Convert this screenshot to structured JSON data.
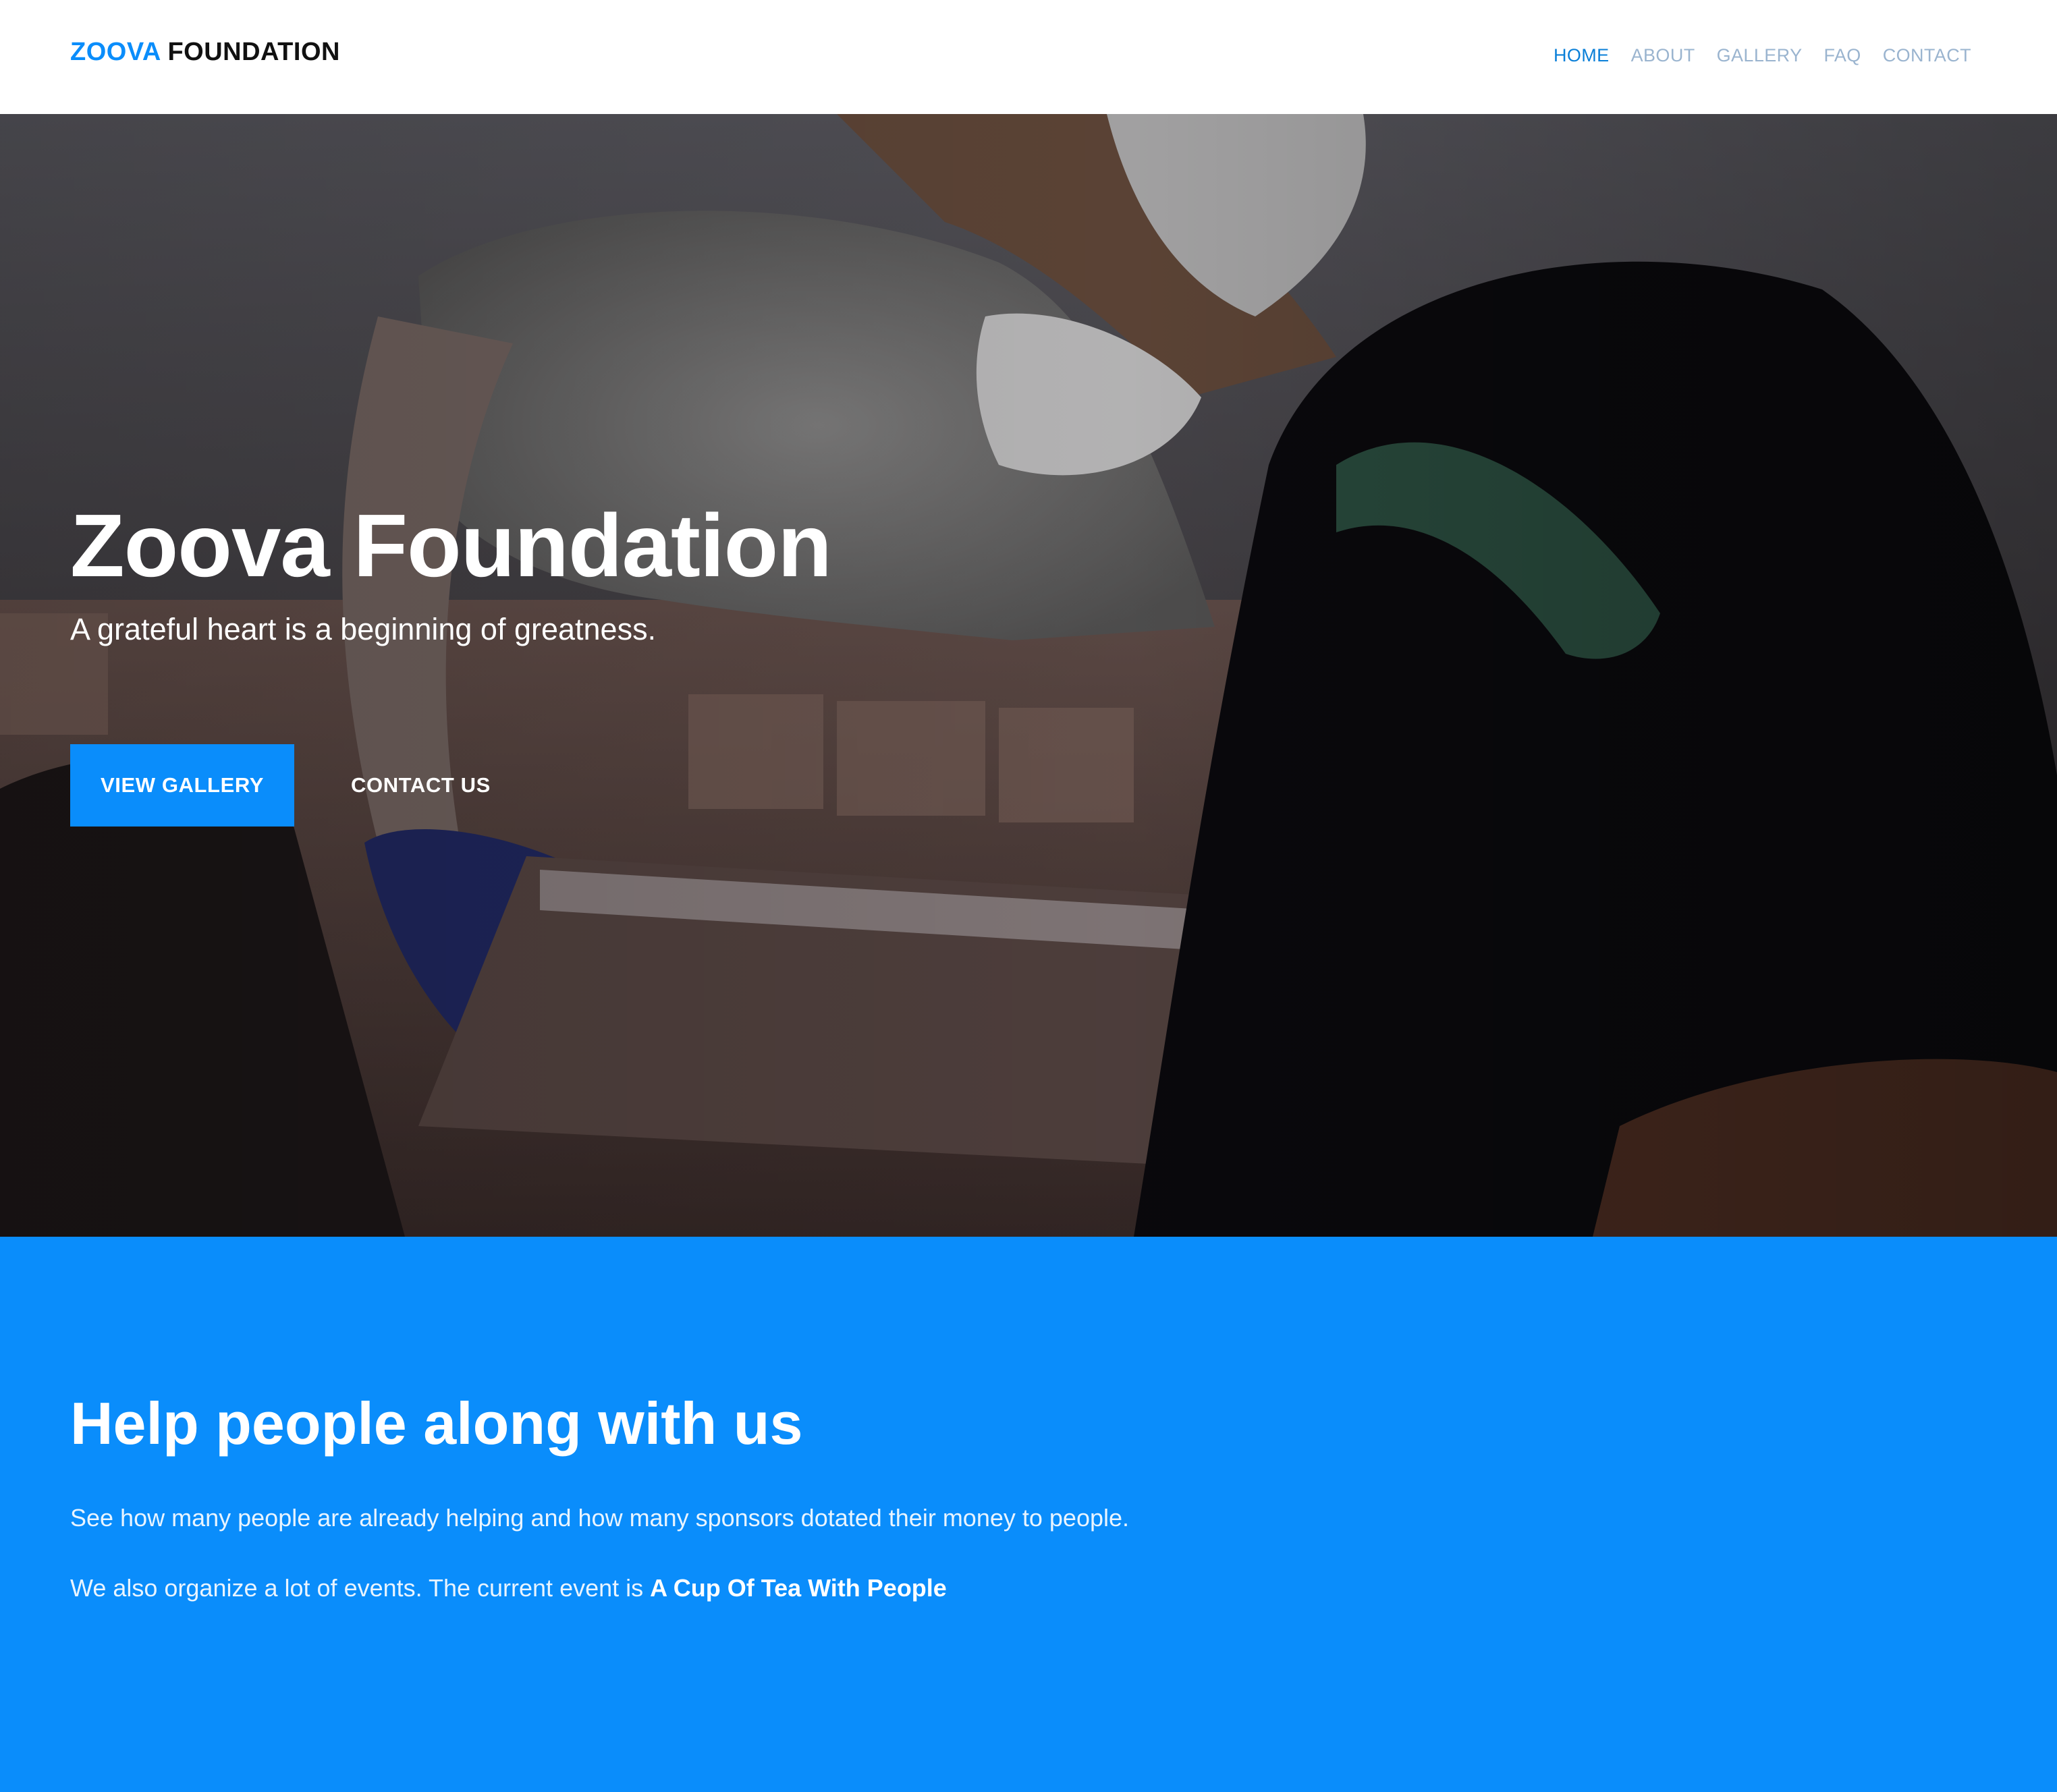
{
  "navbar": {
    "brand_accent": "ZOOVA",
    "brand_rest": "FOUNDATION",
    "links": [
      {
        "label": "HOME",
        "active": true
      },
      {
        "label": "ABOUT",
        "active": false
      },
      {
        "label": "GALLERY",
        "active": false
      },
      {
        "label": "FAQ",
        "active": false
      },
      {
        "label": "CONTACT",
        "active": false
      }
    ]
  },
  "hero": {
    "title": "Zoova Foundation",
    "subtitle": "A grateful heart is a beginning of greatness.",
    "primary_button": "VIEW GALLERY",
    "secondary_button": "CONTACT US"
  },
  "info": {
    "title": "Help people along with us",
    "paragraph1": "See how many people are already helping and how many sponsors dotated their money to people.",
    "paragraph2_prefix": "We also organize a lot of events. The current event is ",
    "paragraph2_event": "A Cup Of Tea With People"
  },
  "colors": {
    "accent": "#0a8dfb",
    "nav_active": "#0a7fd8",
    "nav_inactive": "#9ab4cf",
    "hero_overlay": "#17161b"
  }
}
